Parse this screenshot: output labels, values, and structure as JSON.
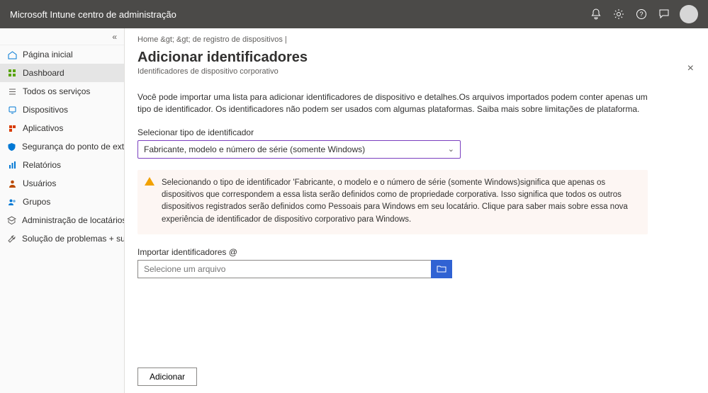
{
  "topbar": {
    "title": "Microsoft Intune centro de administração"
  },
  "sidebar": {
    "items": [
      {
        "label": "Página inicial",
        "icon": "home"
      },
      {
        "label": "Dashboard",
        "icon": "dashboard",
        "active": true
      },
      {
        "label": "Todos os serviços",
        "icon": "list"
      },
      {
        "label": "Dispositivos",
        "icon": "device"
      },
      {
        "label": "Aplicativos",
        "icon": "apps"
      },
      {
        "label": "Segurança do ponto de extremidade",
        "icon": "shield"
      },
      {
        "label": "Relatórios",
        "icon": "report"
      },
      {
        "label": "Usuários",
        "icon": "user"
      },
      {
        "label": "Grupos",
        "icon": "group"
      },
      {
        "label": "Administração de locatários",
        "icon": "tenant"
      },
      {
        "label": "Solução de problemas + suporte",
        "icon": "wrench"
      }
    ]
  },
  "breadcrumb": "Home &gt;   &gt; de registro de dispositivos |",
  "page": {
    "title": "Adicionar identificadores",
    "subtitle": "Identificadores de dispositivo corporativo",
    "intro": "Você pode importar uma lista para adicionar identificadores de dispositivo e detalhes.Os arquivos importados podem conter apenas um tipo de identificador. Os identificadores não podem ser usados com algumas plataformas. Saiba mais sobre limitações de plataforma."
  },
  "identifier_type": {
    "label": "Selecionar tipo de identificador",
    "selected": "Fabricante, modelo e número de série (somente Windows)"
  },
  "warning": "Selecionando o tipo de identificador 'Fabricante, o modelo e o número de série (somente Windows)significa que apenas os dispositivos que correspondem a essa lista serão definidos como de propriedade corporativa. Isso significa que todos os outros dispositivos registrados serão definidos como Pessoais para Windows em seu locatário. Clique para saber mais sobre essa nova experiência de identificador de dispositivo corporativo para Windows.",
  "import": {
    "label": "Importar identificadores @",
    "placeholder": "Selecione um arquivo"
  },
  "footer": {
    "add": "Adicionar"
  }
}
